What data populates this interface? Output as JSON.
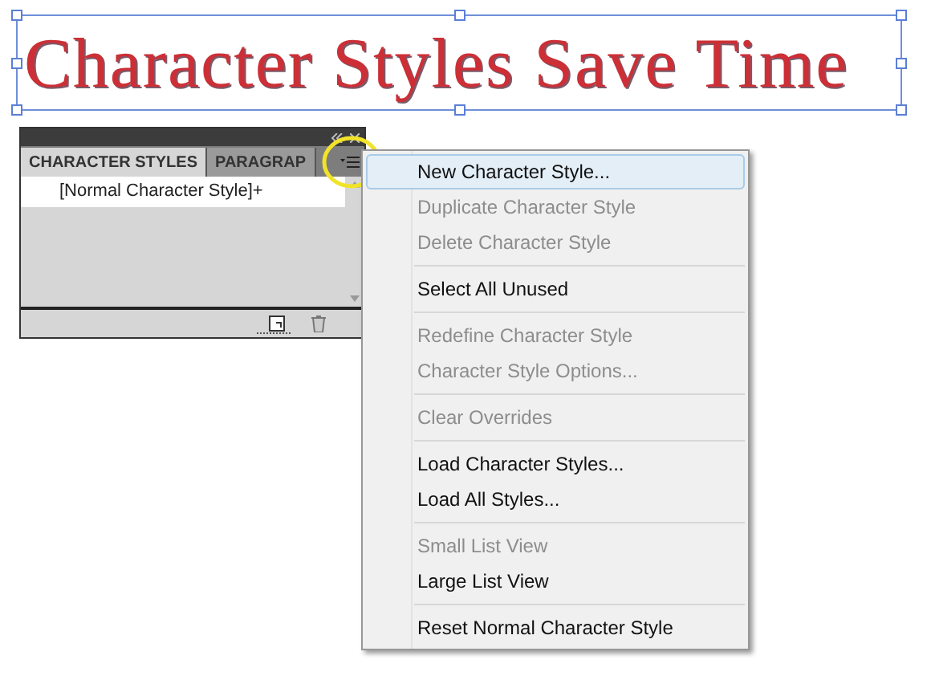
{
  "headline": {
    "text": "Character Styles Save Time",
    "selected": true
  },
  "panel": {
    "tabs": [
      {
        "label": "CHARACTER STYLES",
        "selected": true
      },
      {
        "label": "PARAGRAP",
        "selected": false
      }
    ],
    "styles": [
      {
        "label": "[Normal Character Style]+",
        "selected": true
      }
    ],
    "menu_button_highlighted": true
  },
  "menu": {
    "groups": [
      [
        {
          "label": "New Character Style...",
          "disabled": false,
          "selected": true
        },
        {
          "label": "Duplicate Character Style",
          "disabled": true,
          "selected": false
        },
        {
          "label": "Delete Character Style",
          "disabled": true,
          "selected": false
        }
      ],
      [
        {
          "label": "Select All Unused",
          "disabled": false,
          "selected": false
        }
      ],
      [
        {
          "label": "Redefine Character Style",
          "disabled": true,
          "selected": false
        },
        {
          "label": "Character Style Options...",
          "disabled": true,
          "selected": false
        }
      ],
      [
        {
          "label": "Clear Overrides",
          "disabled": true,
          "selected": false
        }
      ],
      [
        {
          "label": "Load Character Styles...",
          "disabled": false,
          "selected": false
        },
        {
          "label": "Load All Styles...",
          "disabled": false,
          "selected": false
        }
      ],
      [
        {
          "label": "Small List View",
          "disabled": true,
          "selected": false
        },
        {
          "label": "Large List View",
          "disabled": false,
          "selected": false
        }
      ],
      [
        {
          "label": "Reset Normal Character Style",
          "disabled": false,
          "selected": false
        }
      ]
    ]
  }
}
